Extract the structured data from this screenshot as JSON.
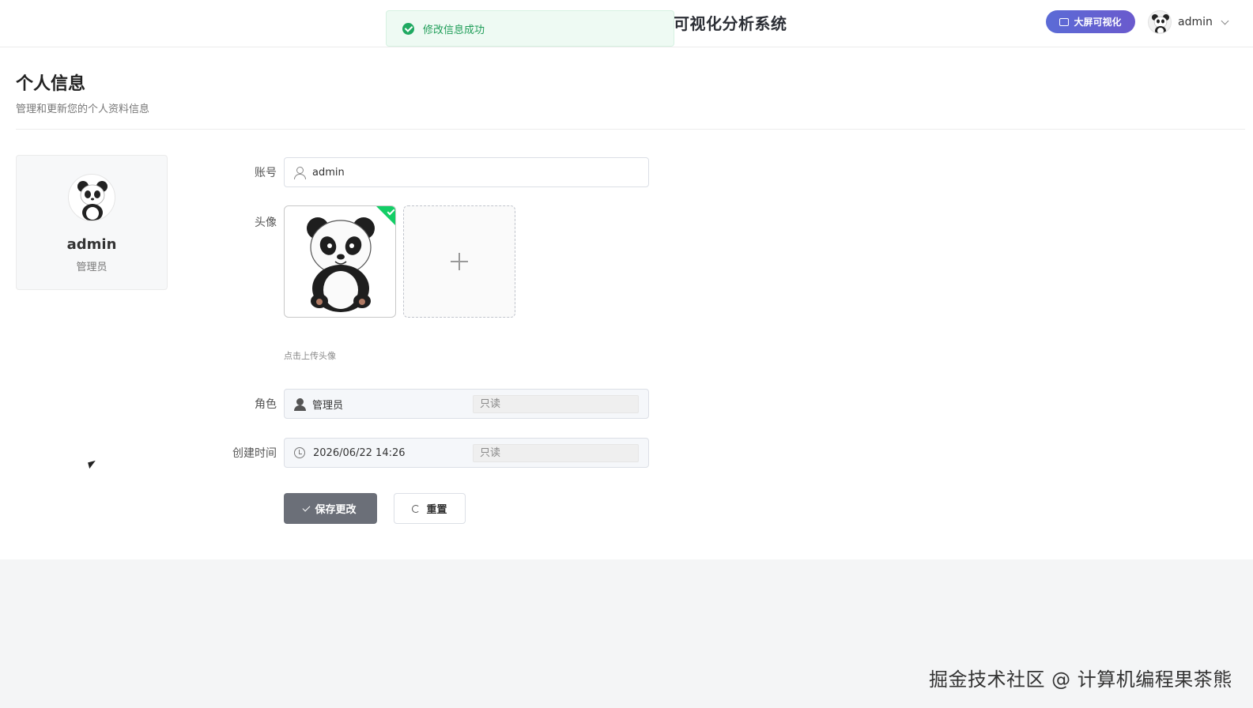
{
  "header": {
    "title": "可视化分析系统",
    "bigscreen_label": "大屏可视化",
    "user_name": "admin"
  },
  "toast": {
    "message": "修改信息成功",
    "type": "success"
  },
  "page": {
    "title": "个人信息",
    "subtitle": "管理和更新您的个人资料信息"
  },
  "profile_card": {
    "name": "admin",
    "role": "管理员"
  },
  "form": {
    "account": {
      "label": "账号",
      "value": "admin"
    },
    "avatar": {
      "label": "头像",
      "hint": "点击上传头像"
    },
    "role": {
      "label": "角色",
      "value": "管理员",
      "readonly": "只读"
    },
    "created": {
      "label": "创建时间",
      "value": "2026/06/22 14:26",
      "readonly": "只读"
    },
    "save_label": "保存更改",
    "reset_label": "重置"
  },
  "watermark": "掘金技术社区 @ 计算机编程果茶熊",
  "colors": {
    "accent": "#5b6bd6",
    "success": "#1fa961",
    "save_button": "#6b6f78"
  }
}
